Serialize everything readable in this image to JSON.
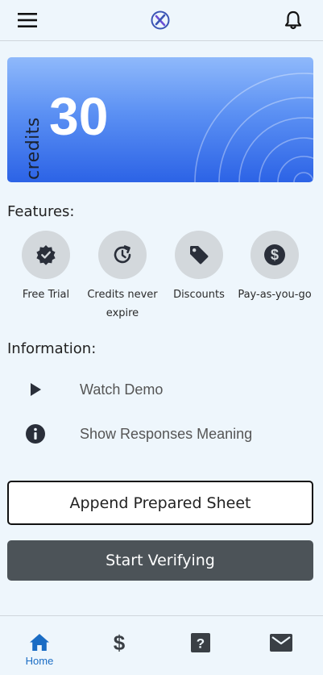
{
  "header": {
    "menu_icon": "hamburger-menu-icon",
    "logo_icon": "x-check-logo-icon",
    "notification_icon": "bell-icon"
  },
  "credits": {
    "label": "credits",
    "value": "30"
  },
  "features": {
    "title": "Features:",
    "items": [
      {
        "label": "Free Trial",
        "icon": "verified-badge-icon"
      },
      {
        "label": "Credits never expire",
        "icon": "clock-refresh-icon"
      },
      {
        "label": "Discounts",
        "icon": "tag-icon"
      },
      {
        "label": "Pay-as-you-go",
        "icon": "dollar-circle-icon"
      }
    ]
  },
  "information": {
    "title": "Information:",
    "items": [
      {
        "label": "Watch Demo",
        "icon": "play-icon"
      },
      {
        "label": "Show Responses Meaning",
        "icon": "info-circle-icon"
      }
    ]
  },
  "actions": {
    "append_label": "Append Prepared Sheet",
    "verify_label": "Start Verifying"
  },
  "bottom_nav": {
    "items": [
      {
        "label": "Home",
        "icon": "home-icon",
        "active": true
      },
      {
        "label": "",
        "icon": "dollar-icon",
        "active": false
      },
      {
        "label": "",
        "icon": "help-question-icon",
        "active": false
      },
      {
        "label": "",
        "icon": "mail-icon",
        "active": false
      }
    ]
  },
  "colors": {
    "background": "#eef6fc",
    "card_gradient_top": "#8fb9fb",
    "card_gradient_bottom": "#2c63e6",
    "primary_button": "#4c5358",
    "active_nav": "#1a6cc4",
    "feature_circle": "#d3d8dc"
  }
}
